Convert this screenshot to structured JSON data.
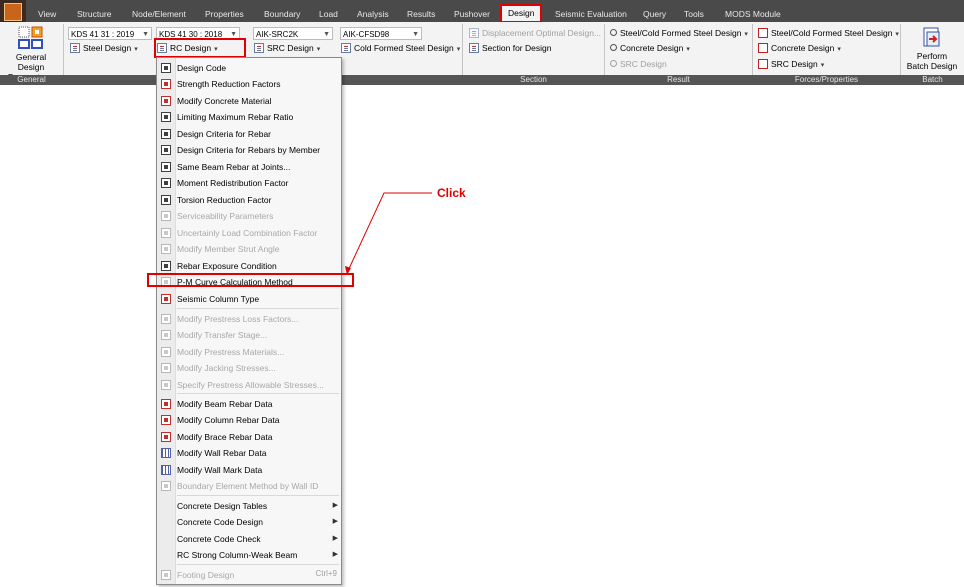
{
  "menubar": {
    "items": [
      "View",
      "Structure",
      "Node/Element",
      "Properties",
      "Boundary",
      "Load",
      "Analysis",
      "Results",
      "Pushover",
      "Design",
      "Seismic Evaluation",
      "Query",
      "Tools",
      "MODS Module"
    ],
    "active": "Design"
  },
  "ribbon": {
    "general": {
      "button_label_1": "General Design",
      "button_label_2": "Parameter",
      "group": "General"
    },
    "combos": {
      "steel_code": "KDS 41 31 : 2019",
      "rc_code": "KDS 41 30 : 2018",
      "src_code": "AIK-SRC2K",
      "cfs_code": "AIK-CFSD98"
    },
    "buttons": {
      "steel_design": "Steel Design",
      "rc_design": "RC Design",
      "src_design": "SRC Design",
      "cold_formed": "Cold Formed Steel Design",
      "displacement_optimal": "Displacement Optimal Design...",
      "section_for_design": "Section for Design",
      "result_steel": "Steel/Cold Formed Steel Design",
      "result_concrete": "Concrete Design",
      "result_src": "SRC Design",
      "forces_steel": "Steel/Cold Formed Steel Design",
      "forces_concrete": "Concrete Design",
      "forces_src": "SRC Design",
      "batch_1": "Perform",
      "batch_2": "Batch Design"
    },
    "groups": {
      "general": "General",
      "section": "Section",
      "result": "Result",
      "forces": "Forces/Properties",
      "batch": "Batch"
    }
  },
  "dropdown": {
    "items": [
      {
        "label": "Design Code",
        "enabled": true
      },
      {
        "label": "Strength Reduction Factors",
        "enabled": true
      },
      {
        "label": "Modify Concrete Material",
        "enabled": true
      },
      {
        "label": "Limiting Maximum Rebar Ratio",
        "enabled": true
      },
      {
        "label": "Design Criteria for Rebar",
        "enabled": true
      },
      {
        "label": "Design Criteria for Rebars by Member",
        "enabled": true
      },
      {
        "label": "Same Beam Rebar at Joints...",
        "enabled": true
      },
      {
        "label": "Moment Redistribution Factor",
        "enabled": true
      },
      {
        "label": "Torsion Reduction Factor",
        "enabled": true
      },
      {
        "label": "Serviceability Parameters",
        "enabled": false
      },
      {
        "label": "Uncertainly Load Combination Factor",
        "enabled": false
      },
      {
        "label": "Modify Member Strut Angle",
        "enabled": false
      },
      {
        "label": "Rebar Exposure Condition",
        "enabled": true
      },
      {
        "label": "P-M Curve Calculation Method",
        "enabled": true
      },
      {
        "label": "Seismic Column Type",
        "enabled": true
      },
      {
        "label": "Modify Prestress Loss Factors...",
        "enabled": false
      },
      {
        "label": "Modify Transfer Stage...",
        "enabled": false
      },
      {
        "label": "Modify Prestress Materials...",
        "enabled": false
      },
      {
        "label": "Modify Jacking Stresses...",
        "enabled": false
      },
      {
        "label": "Specify Prestress Allowable Stresses...",
        "enabled": false
      },
      {
        "label": "Modify Beam Rebar Data",
        "enabled": true
      },
      {
        "label": "Modify Column Rebar Data",
        "enabled": true
      },
      {
        "label": "Modify Brace Rebar Data",
        "enabled": true
      },
      {
        "label": "Modify Wall Rebar Data",
        "enabled": true
      },
      {
        "label": "Modify Wall Mark Data",
        "enabled": true
      },
      {
        "label": "Boundary Element Method by Wall ID",
        "enabled": false
      },
      {
        "label": "Concrete Design Tables",
        "enabled": true
      },
      {
        "label": "Concrete Code Design",
        "enabled": true
      },
      {
        "label": "Concrete Code Check",
        "enabled": true
      },
      {
        "label": "RC Strong Column-Weak Beam",
        "enabled": true
      },
      {
        "label": "Footing Design",
        "enabled": false,
        "shortcut": "Ctrl+9"
      }
    ]
  },
  "annotation": {
    "click_label": "Click"
  },
  "colors": {
    "highlight": "#e00000",
    "menubar": "#4a4a4a",
    "ribbon": "#f3f3f3"
  }
}
